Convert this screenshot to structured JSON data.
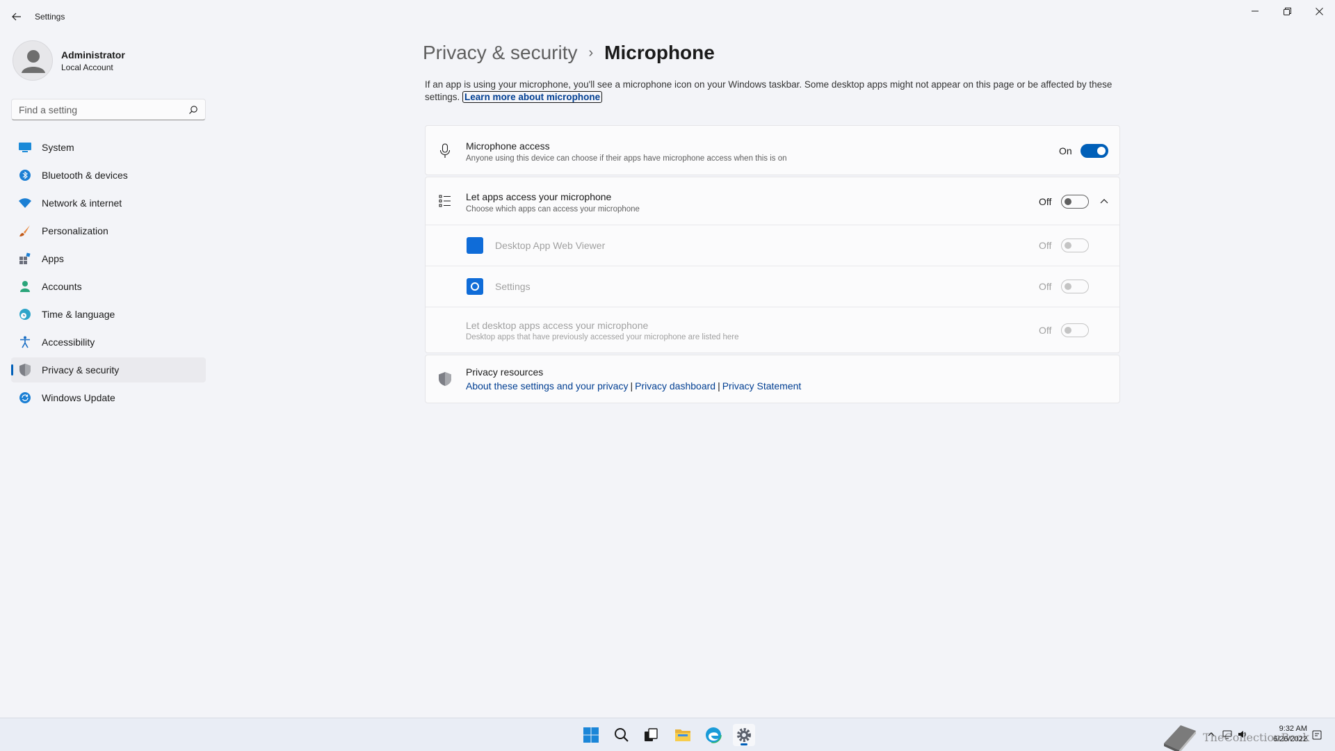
{
  "window": {
    "app_title": "Settings"
  },
  "user": {
    "name": "Administrator",
    "account_type": "Local Account"
  },
  "search": {
    "placeholder": "Find a setting"
  },
  "sidebar": {
    "items": [
      {
        "label": "System",
        "icon": "system-icon",
        "active": false
      },
      {
        "label": "Bluetooth & devices",
        "icon": "bluetooth-icon",
        "active": false
      },
      {
        "label": "Network & internet",
        "icon": "wifi-icon",
        "active": false
      },
      {
        "label": "Personalization",
        "icon": "brush-icon",
        "active": false
      },
      {
        "label": "Apps",
        "icon": "apps-icon",
        "active": false
      },
      {
        "label": "Accounts",
        "icon": "accounts-icon",
        "active": false
      },
      {
        "label": "Time & language",
        "icon": "globe-clock-icon",
        "active": false
      },
      {
        "label": "Accessibility",
        "icon": "accessibility-icon",
        "active": false
      },
      {
        "label": "Privacy & security",
        "icon": "shield-icon",
        "active": true
      },
      {
        "label": "Windows Update",
        "icon": "update-icon",
        "active": false
      }
    ]
  },
  "main": {
    "breadcrumb_parent": "Privacy & security",
    "breadcrumb_sep": "›",
    "title": "Microphone",
    "intro_text": "If an app is using your microphone, you'll see a microphone icon on your Windows taskbar. Some desktop apps might not appear on this page or be affected by these settings.",
    "learn_more_link": "Learn more about microphone",
    "mic_access": {
      "title": "Microphone access",
      "subtitle": "Anyone using this device can choose if their apps have microphone access when this is on",
      "state": "On"
    },
    "app_access": {
      "title": "Let apps access your microphone",
      "subtitle": "Choose which apps can access your microphone",
      "state": "Off",
      "apps": [
        {
          "name": "Desktop App Web Viewer",
          "state": "Off"
        },
        {
          "name": "Settings",
          "state": "Off"
        }
      ],
      "desktop_apps": {
        "title": "Let desktop apps access your microphone",
        "subtitle": "Desktop apps that have previously accessed your microphone are listed here",
        "state": "Off"
      }
    },
    "privacy_resources": {
      "title": "Privacy resources",
      "links": [
        "About these settings and your privacy",
        "Privacy dashboard",
        "Privacy Statement"
      ],
      "separator": "|"
    }
  },
  "taskbar": {
    "time": "9:32 AM",
    "date": "6/26/2022",
    "watermark": "TheCollectionBook"
  },
  "colors": {
    "accent": "#005fb8",
    "link": "#003e92",
    "background": "#f3f4f8",
    "card": "#fbfbfc"
  }
}
